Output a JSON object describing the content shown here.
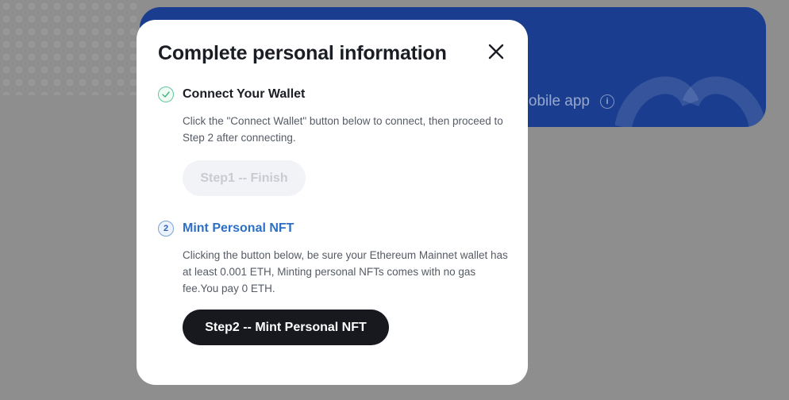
{
  "background": {
    "card_text": "obile app",
    "info_glyph": "i"
  },
  "modal": {
    "title": "Complete personal information",
    "close_icon": "close-icon",
    "steps": [
      {
        "badge": "✓",
        "badge_icon": "check-icon",
        "state": "done",
        "title": "Connect Your Wallet",
        "description": "Click the \"Connect Wallet\" button below to connect, then proceed to Step 2 after connecting.",
        "button_label": "Step1 -- Finish",
        "button_disabled": true
      },
      {
        "badge": "2",
        "state": "active",
        "title": "Mint Personal NFT",
        "description": "Clicking the button below, be sure your Ethereum Mainnet wallet has at least 0.001 ETH, Minting personal NFTs comes with no gas fee.You pay 0 ETH.",
        "button_label": "Step2 -- Mint Personal NFT",
        "button_disabled": false
      }
    ]
  },
  "colors": {
    "overlay": "#8e8e8e",
    "banner": "#1a3d8f",
    "active_step": "#2d6fc6",
    "done_step": "#62c79a",
    "primary_button": "#17191e",
    "disabled_button": "#f2f3f6"
  }
}
